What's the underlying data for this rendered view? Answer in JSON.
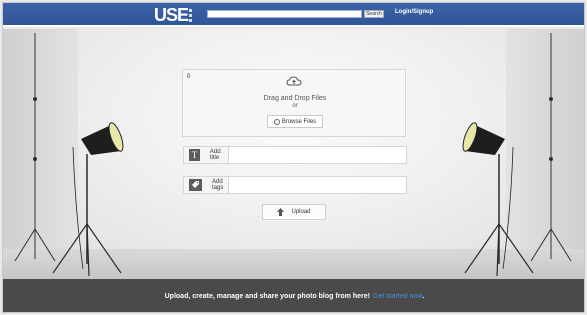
{
  "header": {
    "logo_text": "USE",
    "search": {
      "value": "",
      "placeholder": ""
    },
    "search_button_label": "Search",
    "login_link": "Login/Signup"
  },
  "upload_panel": {
    "file_count": "0",
    "drop_text": "Drag and Drop Files",
    "or_text": "or",
    "browse_label": "Browse Files"
  },
  "fields": {
    "title": {
      "icon_glyph": "T",
      "label": "Add title",
      "value": ""
    },
    "tags": {
      "icon_name": "tag-icon",
      "label": "Add tags",
      "value": ""
    }
  },
  "upload_button": {
    "label": "Upload",
    "icon_name": "up-arrow-icon"
  },
  "footer": {
    "text": "Upload, create, manage and share your photo blog from here!",
    "cta_link": "Get started now",
    "cta_suffix": "."
  },
  "colors": {
    "topbar": "#2f5597",
    "footer_bg": "#4a4a4a",
    "link_blue": "#4a90e2"
  }
}
